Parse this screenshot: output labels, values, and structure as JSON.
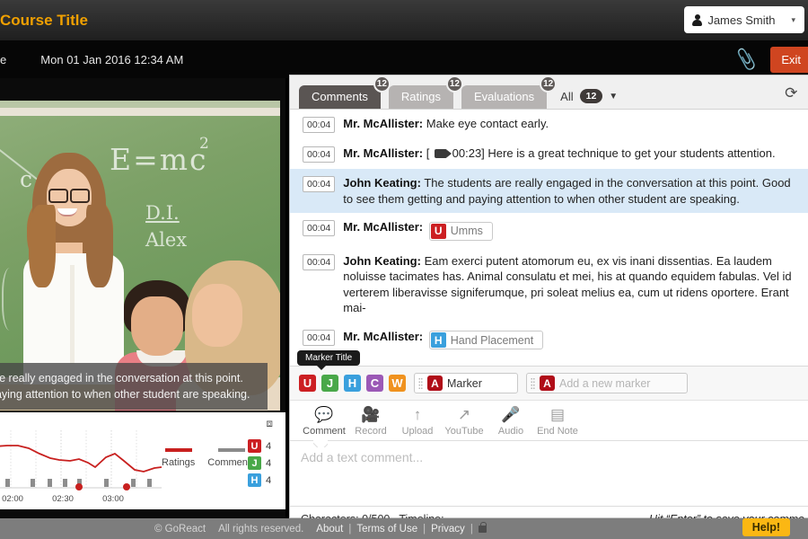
{
  "header": {
    "course_title": "Course Title",
    "user_name": "James Smith",
    "user_icon": "person-icon",
    "caret_icon": "▾"
  },
  "subheader": {
    "name_truncated": "ame",
    "date": "Mon 01 Jan 2016 12:34 AM",
    "attachment_icon": "paperclip-icon",
    "exit_label": "Exit"
  },
  "video": {
    "chalk": {
      "equation": "E=mc",
      "superscript": "2",
      "c": "c",
      "di": "D.I.",
      "alex": "Alex"
    },
    "caption_line1": "are really engaged in the conversation at this point.",
    "caption_line2": "paying attention to when other student are speaking.",
    "expand_icon": "expand-icon"
  },
  "chart_data": {
    "type": "line",
    "title": "",
    "xlabel": "",
    "ylabel": "",
    "grid": true,
    "legend_position": "right",
    "categories": [
      "02:00",
      "02:30",
      "03:00"
    ],
    "tick_labels": [
      "02:00",
      "02:30",
      "03:00"
    ],
    "series": [
      {
        "name": "Ratings",
        "color": "#c8201f",
        "type": "line",
        "x": [
          0,
          6,
          12,
          18,
          24,
          30,
          36,
          42,
          48,
          54,
          60,
          66,
          72,
          78,
          84,
          90,
          96,
          100
        ],
        "values": [
          74,
          75,
          75,
          74,
          70,
          66,
          62,
          60,
          60,
          62,
          62,
          56,
          52,
          58,
          68,
          62,
          50,
          48,
          52
        ]
      },
      {
        "name": "Comments",
        "color": "#8a8a8a",
        "type": "bar",
        "x": [
          7,
          22,
          33,
          42,
          51,
          68,
          80,
          88,
          95
        ],
        "values": [
          1,
          1,
          1,
          1,
          1,
          1,
          1,
          1,
          1
        ]
      }
    ],
    "markers": [
      {
        "x": 51,
        "color": "#c8201f"
      },
      {
        "x": 80,
        "color": "#c8201f"
      }
    ],
    "legend": [
      {
        "label": "Ratings",
        "color": "#c8201f",
        "shape": "line"
      },
      {
        "label": "Comments",
        "color": "#8a8a8a",
        "shape": "bar"
      }
    ],
    "counts": [
      {
        "letter": "U",
        "color": "#cc1f22",
        "value": "4"
      },
      {
        "letter": "J",
        "color": "#49a849",
        "value": "4"
      },
      {
        "letter": "H",
        "color": "#3aa0dd",
        "value": "4"
      }
    ]
  },
  "tabs": [
    {
      "label": "Comments",
      "badge": "12",
      "active": true
    },
    {
      "label": "Ratings",
      "badge": "12",
      "active": false
    },
    {
      "label": "Evaluations",
      "badge": "12",
      "active": false
    }
  ],
  "filter": {
    "all_label": "All",
    "count": "12",
    "caret_icon": "▼"
  },
  "tab_icons": [
    {
      "name": "refresh-icon",
      "glyph": "⟳"
    },
    {
      "name": "print-icon",
      "glyph": "⎙"
    }
  ],
  "comments": [
    {
      "time": "00:04",
      "author": "Mr. McAllister:",
      "text": "Make eye contact early.",
      "highlight": false,
      "kind": "text"
    },
    {
      "time": "00:04",
      "author": "Mr. McAllister:",
      "prefix": "[",
      "video_time": "00:23]",
      "text": "Here is a great technique to get your students attention.",
      "highlight": false,
      "kind": "video"
    },
    {
      "time": "00:04",
      "author": "John Keating:",
      "text": "The students are really engaged in the conversation at this point.  Good to see them getting and paying attention to when other student are speaking.",
      "highlight": true,
      "kind": "text"
    },
    {
      "time": "00:04",
      "author": "Mr. McAllister:",
      "text": "",
      "highlight": false,
      "kind": "marker",
      "marker_letter": "U",
      "marker_color": "#cc1f22",
      "marker_label": "Umms"
    },
    {
      "time": "00:04",
      "author": "John Keating:",
      "text": "Eam exerci putent atomorum eu, ex vis inani dissentias. Ea laudem noluisse tacimates has. Animal consulatu et mei, his at quando equidem fabulas. Vel id verterem liberavisse signiferumque, pri soleat melius ea, cum ut ridens oportere. Erant mai-",
      "highlight": false,
      "kind": "text"
    },
    {
      "time": "00:04",
      "author": "Mr. McAllister:",
      "text": "",
      "highlight": false,
      "kind": "marker",
      "marker_letter": "H",
      "marker_color": "#3aa0dd",
      "marker_label": "Hand Placement"
    }
  ],
  "markers": {
    "tooltip": "Marker Title",
    "buttons": [
      {
        "letter": "U",
        "color": "#cc1f22"
      },
      {
        "letter": "J",
        "color": "#49a849"
      },
      {
        "letter": "H",
        "color": "#3aa0dd"
      },
      {
        "letter": "C",
        "color": "#9b59b6"
      },
      {
        "letter": "W",
        "color": "#f0921e"
      }
    ],
    "existing": {
      "letter": "A",
      "color": "#b00d18",
      "value": "Marker"
    },
    "new": {
      "letter": "A",
      "color": "#b00d18",
      "placeholder": "Add a new marker"
    }
  },
  "toolbar": [
    {
      "label": "Comment",
      "icon": "comment-icon",
      "glyph": "💬",
      "active": true
    },
    {
      "label": "Record",
      "icon": "video-camera-icon",
      "glyph": "📹",
      "active": false
    },
    {
      "label": "Upload",
      "icon": "upload-arrow-icon",
      "glyph": "↑",
      "active": false
    },
    {
      "label": "YouTube",
      "icon": "external-link-icon",
      "glyph": "↗",
      "active": false
    },
    {
      "label": "Audio",
      "icon": "microphone-icon",
      "glyph": "🎤",
      "active": false
    },
    {
      "label": "End Note",
      "icon": "note-icon",
      "glyph": "▤",
      "active": false
    }
  ],
  "composer": {
    "placeholder": "Add a text comment...",
    "characters": "Characters: 0/500",
    "timeline": "Timeline:",
    "hint": "Hit “Enter” to save your comme"
  },
  "footer": {
    "copyright": "© GoReact",
    "rights": "All rights reserved.",
    "links": [
      "About",
      "Terms of Use",
      "Privacy"
    ],
    "lock_icon": "lock-icon",
    "help_label": "Help!"
  }
}
